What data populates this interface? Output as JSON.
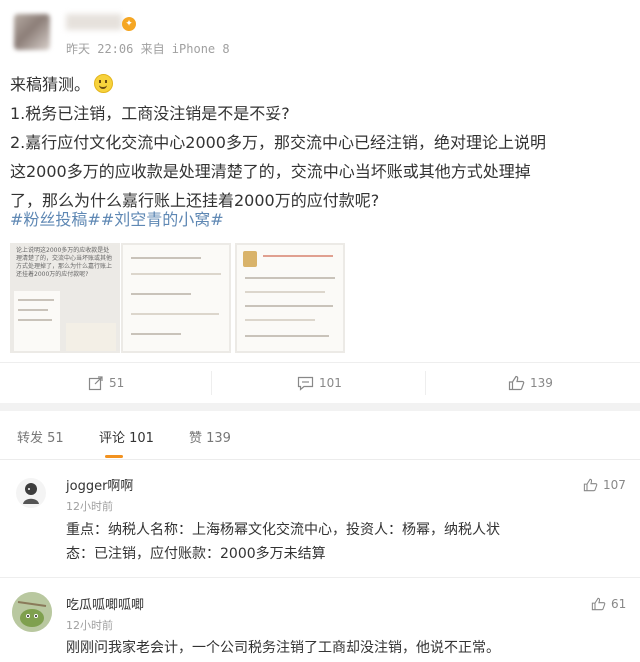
{
  "post": {
    "meta": "昨天 22:06 来自 iPhone 8",
    "line1": "来稿猜测。",
    "line2": "1.税务已注销，工商没注销是不是不妥?",
    "line3": "2.嘉行应付文化交流中心2000多万，那交流中心已经注销，绝对理论上说明",
    "line4": "这2000多万的应收款是处理清楚了的，交流中心当坏账或其他方式处理掉",
    "line5": "了，那么为什么嘉行账上还挂着2000万的应付款呢?",
    "hashtags": "#粉丝投稿##刘空青的小窝#",
    "thumb1_text": "论上说明这2000多万的应收款是处理清楚了的，交流中心当坏账或其他方式处理掉了，那么为什么嘉行账上还挂着2000万的应付款呢?"
  },
  "actions": {
    "repost_count": "51",
    "comment_count": "101",
    "like_count": "139"
  },
  "tabs": {
    "repost": "转发 51",
    "comments": "评论 101",
    "likes": "赞 139"
  },
  "comments": [
    {
      "name": "jogger啊啊",
      "time": "12小时前",
      "likes": "107",
      "text1": "重点：纳税人名称：上海杨幂文化交流中心，投资人：杨幂，纳税人状",
      "text2": "态：已注销，应付账款：2000多万未结算"
    },
    {
      "name": "吃瓜呱唧呱唧",
      "time": "12小时前",
      "likes": "61",
      "text1": "刚刚问我家老会计，一个公司税务注销了工商却没注销，他说不正常。"
    }
  ],
  "colors": {
    "hashtag": "#5f88b4",
    "accent": "#f29220",
    "muted": "#a0a0a0"
  },
  "icons": [
    "repost-icon",
    "comment-icon",
    "like-icon"
  ]
}
